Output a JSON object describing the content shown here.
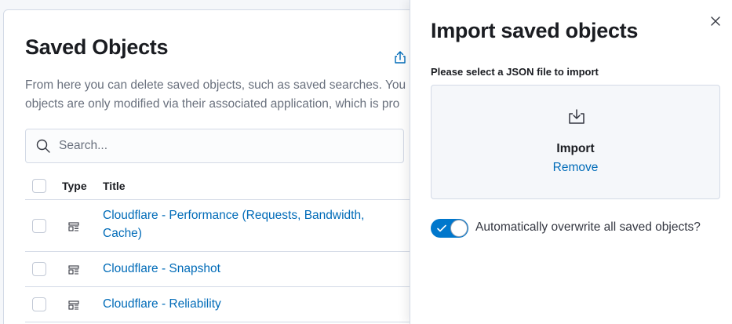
{
  "page": {
    "title": "Saved Objects",
    "description_line1": "From here you can delete saved objects, such as saved searches. You",
    "description_line2": "objects are only modified via their associated application, which is pro",
    "export_icon": "export-icon"
  },
  "search": {
    "placeholder": "Search...",
    "value": "",
    "icon": "search-icon"
  },
  "table": {
    "columns": {
      "type": "Type",
      "title": "Title"
    },
    "rows": [
      {
        "type_icon": "dashboard-icon",
        "title": "Cloudflare - Performance (Requests, Bandwidth, Cache)"
      },
      {
        "type_icon": "dashboard-icon",
        "title": "Cloudflare - Snapshot"
      },
      {
        "type_icon": "dashboard-icon",
        "title": "Cloudflare - Reliability"
      }
    ]
  },
  "flyout": {
    "title": "Import saved objects",
    "close_icon": "close-icon",
    "file_label": "Please select a JSON file to import",
    "dropzone": {
      "icon": "import-icon",
      "label": "Import",
      "remove_label": "Remove"
    },
    "overwrite_toggle": {
      "checked": true,
      "label": "Automatically overwrite all saved objects?"
    }
  },
  "colors": {
    "link": "#006bb8",
    "toggle_on": "#0077cc",
    "heading": "#1a1c21",
    "muted": "#69707d"
  }
}
